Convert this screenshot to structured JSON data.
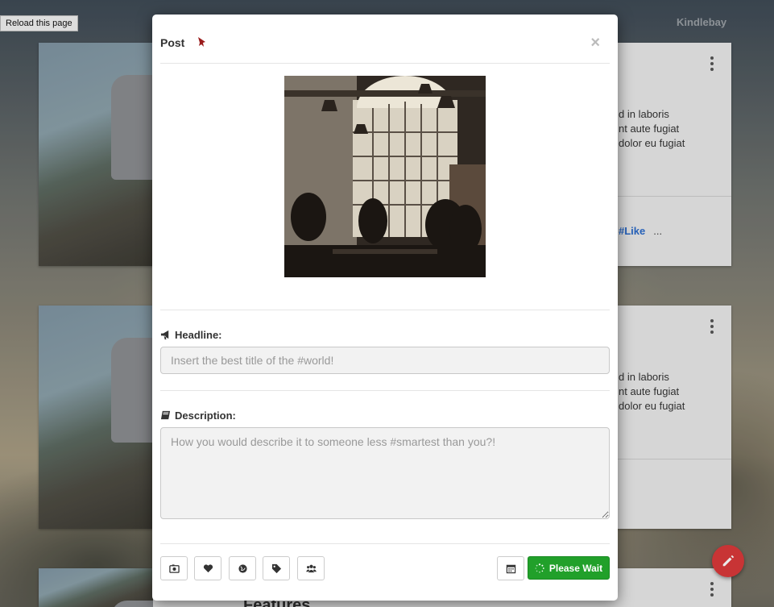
{
  "page": {
    "reload_label": "Reload this page",
    "brand": "Kindlebay"
  },
  "background_cards": [
    {
      "lorem": [
        "d in laboris",
        "nt aute fugiat",
        "dolor eu fugiat"
      ],
      "tag": "#Like",
      "more": "..."
    },
    {
      "lorem": [
        "d in laboris",
        "nt aute fugiat",
        "dolor eu fugiat"
      ]
    }
  ],
  "background_heading": "Features",
  "modal": {
    "title": "Post",
    "close_label": "×",
    "headline": {
      "label": "Headline:",
      "placeholder": "Insert the best title of the #world!"
    },
    "description": {
      "label": "Description:",
      "placeholder": "How you would describe it to someone less #smartest than you?!"
    },
    "toolbar": [
      "camera-icon",
      "heart-icon",
      "globe-icon",
      "tags-icon",
      "users-icon"
    ],
    "submit_label": "Please Wait"
  },
  "colors": {
    "submit": "#21a02a",
    "fab": "#d9393a",
    "rocket": "#9b1c1c"
  }
}
